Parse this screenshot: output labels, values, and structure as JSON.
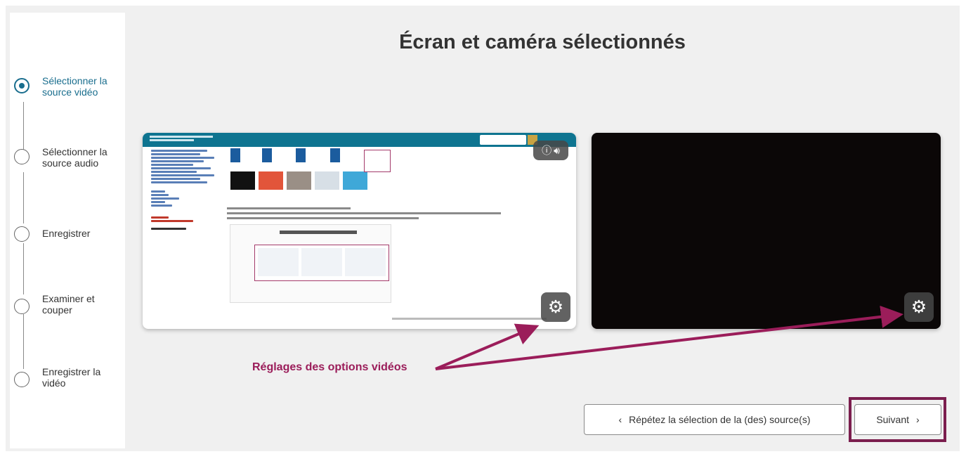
{
  "page": {
    "title": "Écran et caméra sélectionnés"
  },
  "steps": [
    {
      "label": "Sélectionner la source vidéo",
      "state": "active"
    },
    {
      "label": "Sélectionner la source audio",
      "state": "pending"
    },
    {
      "label": "Enregistrer",
      "state": "pending"
    },
    {
      "label": "Examiner et couper",
      "state": "pending"
    },
    {
      "label": "Enregistrer la vidéo",
      "state": "pending"
    }
  ],
  "previews": {
    "screen": {
      "info_icon": "info-icon",
      "sound_icon": "speaker-icon",
      "settings_icon": "gear-icon"
    },
    "camera": {
      "settings_icon": "gear-icon"
    }
  },
  "annotation": {
    "label": "Réglages des options vidéos",
    "color": "#9b1d5a"
  },
  "buttons": {
    "back_label": "Répétez la sélection de la (des) source(s)",
    "next_label": "Suivant",
    "back_icon": "chevron-left-icon",
    "next_icon": "chevron-right-icon"
  },
  "colors": {
    "accent": "#1a6e8e",
    "highlight": "#7b1e4e",
    "background": "#f0f0f0"
  }
}
